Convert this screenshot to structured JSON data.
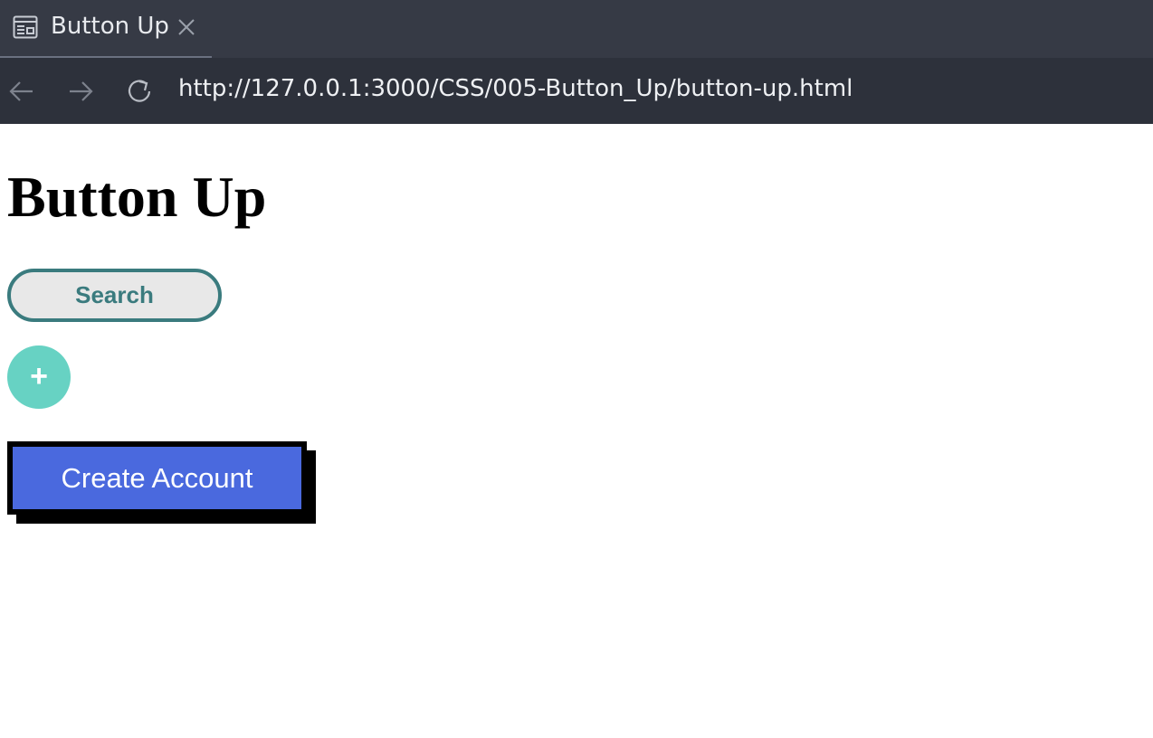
{
  "browser": {
    "tab": {
      "title": "Button Up",
      "icon": "page-layout-icon",
      "close_icon": "close-icon"
    },
    "nav": {
      "back_icon": "arrow-left-icon",
      "forward_icon": "arrow-right-icon",
      "reload_icon": "reload-icon",
      "url": "http://127.0.0.1:3000/CSS/005-Button_Up/button-up.html"
    },
    "colors": {
      "tabbar_bg": "#363a45",
      "navbar_bg": "#2d313b"
    }
  },
  "page": {
    "title": "Button Up",
    "search_button_label": "Search",
    "plus_button_label": "+",
    "create_account_label": "Create Account",
    "colors": {
      "search_border": "#3a7b7e",
      "search_bg": "#e8e8e8",
      "plus_bg": "#67d2c3",
      "create_bg": "#4a69de",
      "create_border": "#000000"
    }
  }
}
